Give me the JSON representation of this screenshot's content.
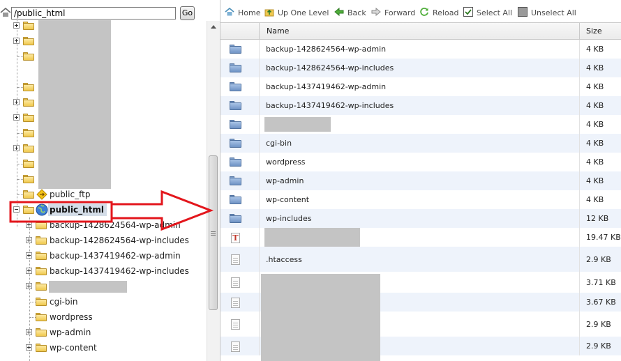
{
  "left_pane": {
    "path_value": "/public_html",
    "go_label": "Go",
    "tree": {
      "public_ftp": "public_ftp",
      "public_html": "public_html",
      "children": [
        "backup-1428624564-wp-admin",
        "backup-1428624564-wp-includes",
        "backup-1437419462-wp-admin",
        "backup-1437419462-wp-includes",
        "",
        "cgi-bin",
        "wordpress",
        "wp-admin",
        "wp-content"
      ]
    }
  },
  "toolbar": {
    "home": "Home",
    "up_one_level": "Up One Level",
    "back": "Back",
    "forward": "Forward",
    "reload": "Reload",
    "select_all": "Select All",
    "unselect_all": "Unselect All"
  },
  "file_table": {
    "headers": {
      "name": "Name",
      "size": "Size"
    },
    "rows": [
      {
        "name": "backup-1428624564-wp-admin",
        "size": "4 KB",
        "icon": "folder-icon"
      },
      {
        "name": "backup-1428624564-wp-includes",
        "size": "4 KB",
        "icon": "folder-icon"
      },
      {
        "name": "backup-1437419462-wp-admin",
        "size": "4 KB",
        "icon": "folder-icon"
      },
      {
        "name": "backup-1437419462-wp-includes",
        "size": "4 KB",
        "icon": "folder-icon"
      },
      {
        "name": "",
        "size": "4 KB",
        "icon": "folder-icon"
      },
      {
        "name": "cgi-bin",
        "size": "4 KB",
        "icon": "folder-icon"
      },
      {
        "name": "wordpress",
        "size": "4 KB",
        "icon": "folder-icon"
      },
      {
        "name": "wp-admin",
        "size": "4 KB",
        "icon": "folder-icon"
      },
      {
        "name": "wp-content",
        "size": "4 KB",
        "icon": "folder-icon"
      },
      {
        "name": "wp-includes",
        "size": "12 KB",
        "icon": "folder-icon"
      },
      {
        "name": "",
        "size": "19.47 KB",
        "icon": "text-file-icon"
      },
      {
        "name": ".htaccess",
        "size": "2.9 KB",
        "icon": "file-icon"
      },
      {
        "name": "",
        "size": "3.71 KB",
        "icon": "file-icon"
      },
      {
        "name": "",
        "size": "3.67 KB",
        "icon": "file-icon"
      },
      {
        "name": "",
        "size": "2.9 KB",
        "icon": "file-icon"
      },
      {
        "name": "",
        "size": "2.9 KB",
        "icon": "file-icon"
      }
    ]
  },
  "colors": {
    "accent_red": "#e3161c",
    "row_alt": "#eef3fb",
    "folder_blue": "#6f93c5",
    "folder_yellow": "#f0c94e"
  }
}
